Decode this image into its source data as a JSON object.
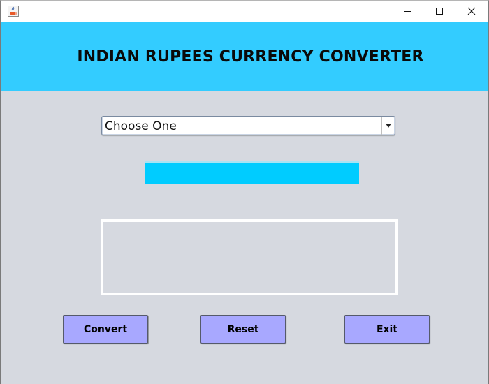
{
  "window": {
    "app_icon": "java-cup-icon",
    "controls": {
      "minimize_icon": "minimize-icon",
      "maximize_icon": "maximize-icon",
      "close_icon": "close-icon"
    }
  },
  "header": {
    "title": "INDIAN RUPEES CURRENCY CONVERTER",
    "background": "#33ccff"
  },
  "form": {
    "currency_select": {
      "selected": "Choose One",
      "arrow_icon": "triangle-down-icon"
    },
    "amount_input": {
      "value": "",
      "background": "#00ccff"
    },
    "result": {
      "text": ""
    }
  },
  "buttons": {
    "convert_label": "Convert",
    "reset_label": "Reset",
    "exit_label": "Exit",
    "background": "#a8a8ff"
  },
  "colors": {
    "panel_background": "#d6d9e0"
  }
}
